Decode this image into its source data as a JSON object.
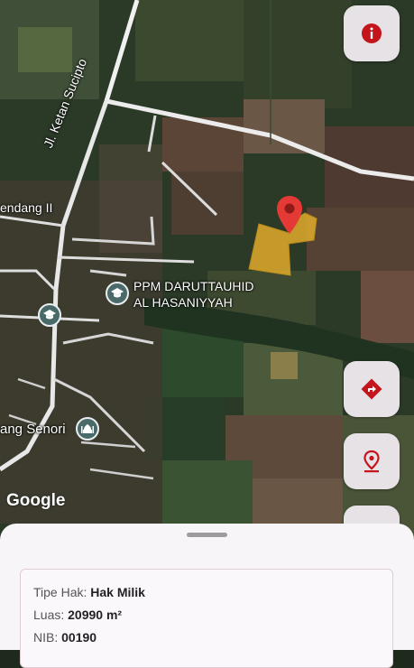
{
  "map": {
    "labels": {
      "road_ketan_sucipto": "Jl. Ketan Sucipto",
      "road_endang": "endang II",
      "poi_ppm_line1": "PPM DARUTTAUHID",
      "poi_ppm_line2": "AL HASANIYYAH",
      "poi_senori": "ang Senori"
    },
    "attribution": "Google",
    "marker_color": "#e53935",
    "parcel_color": "#e0ac2b"
  },
  "actions": {
    "info_icon": "info-icon",
    "directions_icon": "directions-icon",
    "location_icon": "location-pin-icon",
    "accent_color": "#c4141c"
  },
  "details": {
    "tipe_hak_label": "Tipe Hak:",
    "tipe_hak_value": "Hak Milik",
    "luas_label": "Luas:",
    "luas_value": "20990 m²",
    "nib_label": "NIB:",
    "nib_value": "00190"
  }
}
